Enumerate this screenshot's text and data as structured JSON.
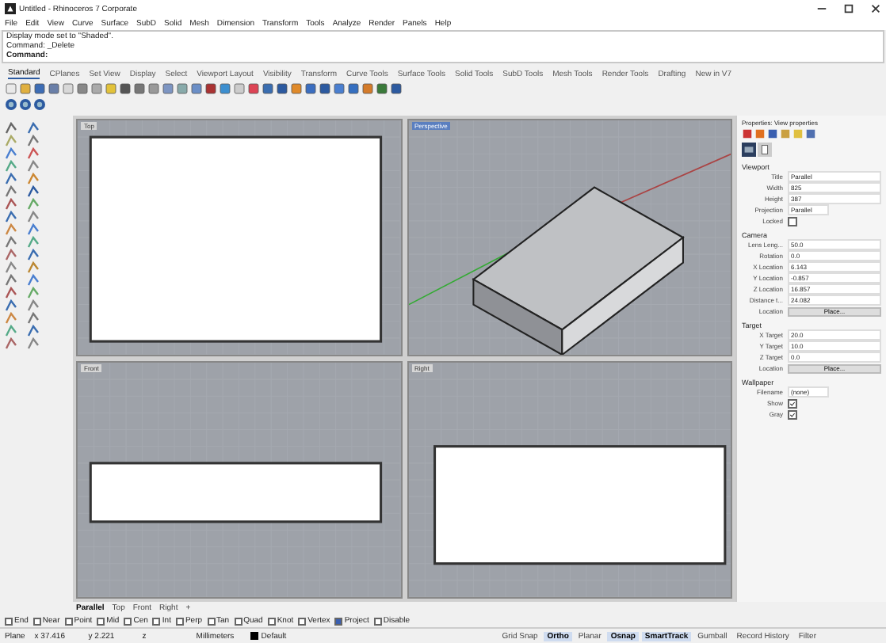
{
  "window": {
    "title": "Untitled - Rhinoceros 7 Corporate"
  },
  "menu": [
    "File",
    "Edit",
    "View",
    "Curve",
    "Surface",
    "SubD",
    "Solid",
    "Mesh",
    "Dimension",
    "Transform",
    "Tools",
    "Analyze",
    "Render",
    "Panels",
    "Help"
  ],
  "command_history": [
    "Display mode set to \"Shaded\".",
    "Command: _Delete"
  ],
  "command_prompt": "Command:",
  "toolbar_tabs": [
    {
      "label": "Standard",
      "selected": true
    },
    {
      "label": "CPlanes",
      "selected": false
    },
    {
      "label": "Set View",
      "selected": false
    },
    {
      "label": "Display",
      "selected": false
    },
    {
      "label": "Select",
      "selected": false
    },
    {
      "label": "Viewport Layout",
      "selected": false
    },
    {
      "label": "Visibility",
      "selected": false
    },
    {
      "label": "Transform",
      "selected": false
    },
    {
      "label": "Curve Tools",
      "selected": false
    },
    {
      "label": "Surface Tools",
      "selected": false
    },
    {
      "label": "Solid Tools",
      "selected": false
    },
    {
      "label": "SubD Tools",
      "selected": false
    },
    {
      "label": "Mesh Tools",
      "selected": false
    },
    {
      "label": "Render Tools",
      "selected": false
    },
    {
      "label": "Drafting",
      "selected": false
    },
    {
      "label": "New in V7",
      "selected": false
    }
  ],
  "viewports": [
    {
      "title": "Top",
      "kind": "plan",
      "active": false
    },
    {
      "title": "Perspective",
      "kind": "perspective",
      "active": true
    },
    {
      "title": "Front",
      "kind": "elevation",
      "active": false
    },
    {
      "title": "Right",
      "kind": "side",
      "active": false
    }
  ],
  "viewport_tabs": [
    {
      "label": "Parallel",
      "selected": true
    },
    {
      "label": "Top",
      "selected": false
    },
    {
      "label": "Front",
      "selected": false
    },
    {
      "label": "Right",
      "selected": false
    },
    {
      "label": "+",
      "selected": false
    }
  ],
  "properties": {
    "title": "Properties: View properties",
    "sections": [
      {
        "heading": "Viewport",
        "rows": [
          {
            "label": "Title",
            "kind": "text",
            "value": "Parallel"
          },
          {
            "label": "Width",
            "kind": "text",
            "value": "825"
          },
          {
            "label": "Height",
            "kind": "text",
            "value": "387"
          },
          {
            "label": "Projection",
            "kind": "dropdown",
            "value": "Parallel"
          },
          {
            "label": "Locked",
            "kind": "check",
            "checked": false
          }
        ]
      },
      {
        "heading": "Camera",
        "rows": [
          {
            "label": "Lens Leng...",
            "kind": "text",
            "value": "50.0"
          },
          {
            "label": "Rotation",
            "kind": "text",
            "value": "0.0"
          },
          {
            "label": "X Location",
            "kind": "text",
            "value": "6.143"
          },
          {
            "label": "Y Location",
            "kind": "text",
            "value": "-0.857"
          },
          {
            "label": "Z Location",
            "kind": "text",
            "value": "16.857"
          },
          {
            "label": "Distance t...",
            "kind": "text",
            "value": "24.082"
          },
          {
            "label": "Location",
            "kind": "button",
            "value": "Place..."
          }
        ]
      },
      {
        "heading": "Target",
        "rows": [
          {
            "label": "X Target",
            "kind": "text",
            "value": "20.0"
          },
          {
            "label": "Y Target",
            "kind": "text",
            "value": "10.0"
          },
          {
            "label": "Z Target",
            "kind": "text",
            "value": "0.0"
          },
          {
            "label": "Location",
            "kind": "button",
            "value": "Place..."
          }
        ]
      },
      {
        "heading": "Wallpaper",
        "rows": [
          {
            "label": "Filename",
            "kind": "dropdown",
            "value": "(none)"
          },
          {
            "label": "Show",
            "kind": "check",
            "checked": true
          },
          {
            "label": "Gray",
            "kind": "check",
            "checked": true
          }
        ]
      }
    ]
  },
  "osnaps": [
    {
      "label": "End",
      "checked": false
    },
    {
      "label": "Near",
      "checked": false
    },
    {
      "label": "Point",
      "checked": false
    },
    {
      "label": "Mid",
      "checked": false
    },
    {
      "label": "Cen",
      "checked": false
    },
    {
      "label": "Int",
      "checked": false
    },
    {
      "label": "Perp",
      "checked": false
    },
    {
      "label": "Tan",
      "checked": false
    },
    {
      "label": "Quad",
      "checked": false
    },
    {
      "label": "Knot",
      "checked": false
    },
    {
      "label": "Vertex",
      "checked": false
    },
    {
      "label": "Project",
      "checked": true
    },
    {
      "label": "Disable",
      "checked": false
    }
  ],
  "status_bar": {
    "plane": "Plane",
    "coords": [
      "x 37.416",
      "y 2.221",
      "z"
    ],
    "units": "Millimeters",
    "layer": "Default",
    "toggles": [
      {
        "label": "Grid Snap",
        "on": false
      },
      {
        "label": "Ortho",
        "on": true
      },
      {
        "label": "Planar",
        "on": false
      },
      {
        "label": "Osnap",
        "on": true
      },
      {
        "label": "SmartTrack",
        "on": true
      },
      {
        "label": "Gumball",
        "on": false
      },
      {
        "label": "Record History",
        "on": false
      },
      {
        "label": "Filter",
        "on": false
      }
    ]
  }
}
